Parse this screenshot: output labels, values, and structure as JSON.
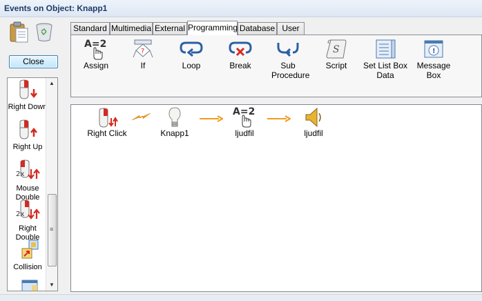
{
  "window": {
    "title": "Events on Object: Knapp1"
  },
  "left": {
    "close_label": "Close",
    "events": [
      {
        "label": "Right Down",
        "icon": "mouse-right-down-icon"
      },
      {
        "label": "Right Up",
        "icon": "mouse-right-up-icon"
      },
      {
        "label": "Mouse Double",
        "icon": "mouse-double-click-icon"
      },
      {
        "label": "Right Double",
        "icon": "mouse-right-double-icon"
      },
      {
        "label": "Collision",
        "icon": "collision-icon"
      }
    ]
  },
  "tabs": [
    {
      "label": "Standard",
      "active": false
    },
    {
      "label": "Multimedia",
      "active": false
    },
    {
      "label": "External",
      "active": false
    },
    {
      "label": "Programming",
      "active": true
    },
    {
      "label": "Database",
      "active": false
    },
    {
      "label": "User",
      "active": false
    }
  ],
  "tools": [
    {
      "label": "Assign",
      "icon": "assign-icon"
    },
    {
      "label": "If",
      "icon": "if-icon"
    },
    {
      "label": "Loop",
      "icon": "loop-icon"
    },
    {
      "label": "Break",
      "icon": "break-icon"
    },
    {
      "label": "Sub Procedure",
      "icon": "sub-procedure-icon"
    },
    {
      "label": "Script",
      "icon": "script-icon"
    },
    {
      "label": "Set List Box Data",
      "icon": "list-box-icon"
    },
    {
      "label": "Message Box",
      "icon": "message-box-icon"
    }
  ],
  "flow": [
    {
      "label": "Right Click",
      "icon": "mouse-right-click-icon"
    },
    {
      "label": "Knapp1",
      "icon": "lightbulb-icon"
    },
    {
      "label": "ljudfil",
      "icon": "assign-icon"
    },
    {
      "label": "ljudfil",
      "icon": "speaker-icon"
    }
  ],
  "assign_glyph": "A=2",
  "colors": {
    "accent": "#1e3b68",
    "arrow": "#f29b1e",
    "mouse_red": "#d42a20"
  }
}
